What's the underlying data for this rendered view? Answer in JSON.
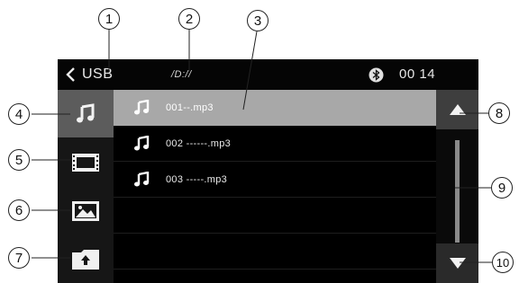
{
  "status_bar": {
    "back_label": "USB",
    "path": "/D://",
    "bluetooth_icon": "bluetooth-icon",
    "clock": "00 14"
  },
  "sidebar": {
    "items": [
      {
        "name": "music",
        "icon": "music-note-icon",
        "active": true
      },
      {
        "name": "video",
        "icon": "film-icon",
        "active": false
      },
      {
        "name": "photo",
        "icon": "image-icon",
        "active": false
      },
      {
        "name": "folder",
        "icon": "folder-up-icon",
        "active": false
      }
    ]
  },
  "file_list": [
    {
      "name": "001--.mp3",
      "icon": "music-note-icon",
      "selected": true
    },
    {
      "name": "002 ------.mp3",
      "icon": "music-note-icon",
      "selected": false
    },
    {
      "name": "003 -----.mp3",
      "icon": "music-note-icon",
      "selected": false
    }
  ],
  "scroll": {
    "up_icon": "scroll-up-arrow-icon",
    "down_icon": "scroll-down-arrow-icon"
  },
  "callouts": [
    "1",
    "2",
    "3",
    "4",
    "5",
    "6",
    "7",
    "8",
    "9",
    "10"
  ],
  "colors": {
    "selected_row": "#a8a8a8",
    "active_sidebar": "#5c5c5c",
    "screen_bg": "#000000",
    "sidebar_bg": "#161616"
  }
}
